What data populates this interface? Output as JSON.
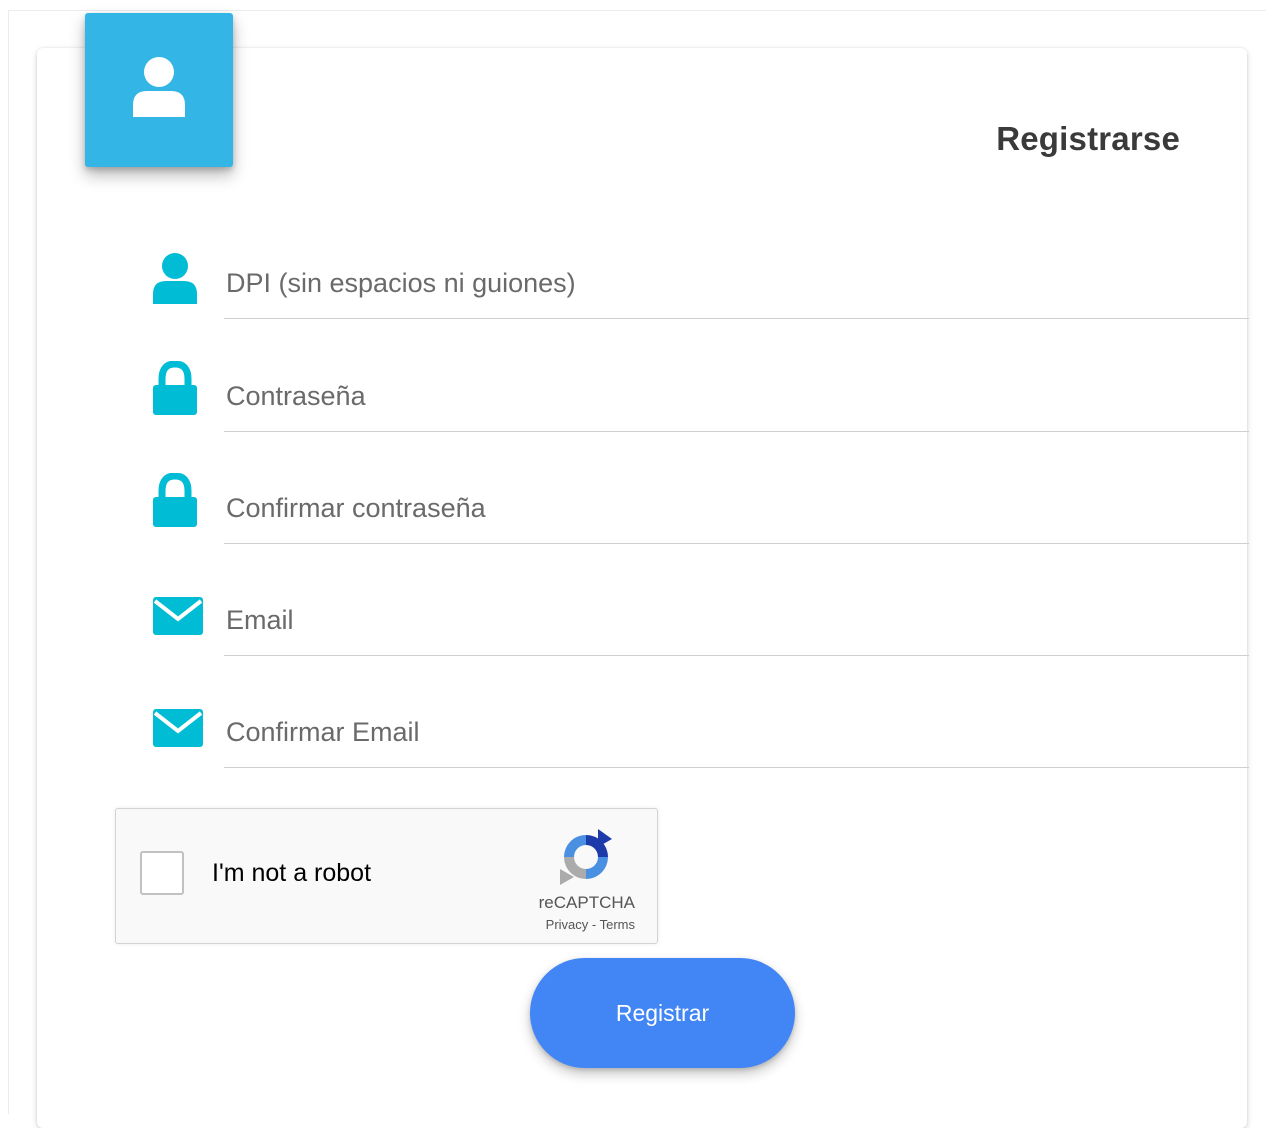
{
  "form": {
    "title": "Registrarse",
    "accent_color": "#00bcd4",
    "header_color": "#33b5e5",
    "header_icon": "user-icon",
    "fields": [
      {
        "icon": "user-icon",
        "value": "",
        "placeholder": "DPI (sin espacios ni guiones)"
      },
      {
        "icon": "lock-icon",
        "value": "",
        "placeholder": "Contraseña"
      },
      {
        "icon": "lock-icon",
        "value": "",
        "placeholder": "Confirmar contraseña"
      },
      {
        "icon": "envelope-icon",
        "value": "",
        "placeholder": "Email"
      },
      {
        "icon": "envelope-icon",
        "value": "",
        "placeholder": "Confirmar Email"
      }
    ],
    "recaptcha": {
      "label": "I'm not a robot",
      "checked": false,
      "brand": "reCAPTCHA",
      "privacy": "Privacy",
      "separator": " - ",
      "terms": "Terms"
    },
    "submit_label": "Registrar",
    "submit_color": "#4285f4"
  }
}
